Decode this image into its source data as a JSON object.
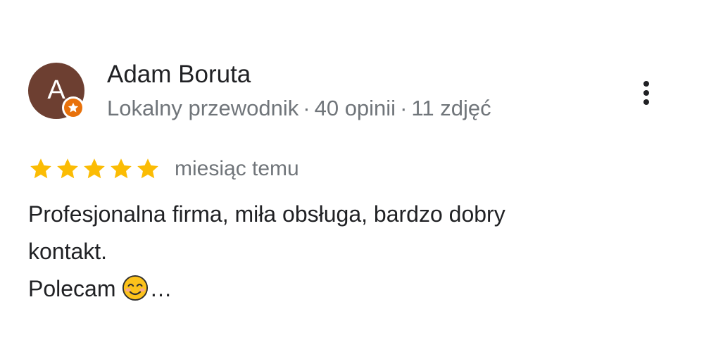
{
  "reviewer": {
    "avatar_letter": "A",
    "name": "Adam Boruta",
    "level": "Lokalny przewodnik",
    "reviews_count": "40 opinii",
    "photos_count": "11 zdjęć",
    "separator": "·"
  },
  "review": {
    "rating": 5,
    "rating_max": 5,
    "date": "miesiąc temu",
    "text_line1": "Profesjonalna firma, miła obsługa, bardzo dobry",
    "text_line2": "kontakt.",
    "text_line3": "Polecam",
    "emoji": "smiling-face-icon",
    "truncation": "…"
  },
  "colors": {
    "avatar_bg": "#6d3f31",
    "badge": "#e8710a",
    "star": "#fbbc04",
    "meta_text": "#70757a",
    "body_text": "#202124"
  }
}
